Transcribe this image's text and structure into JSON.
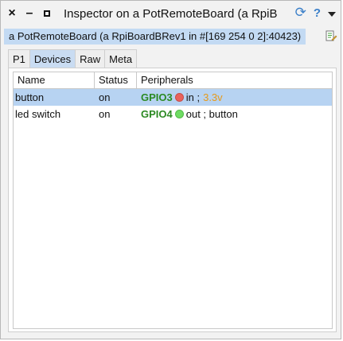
{
  "window": {
    "title": "Inspector on a PotRemoteBoard (a RpiB",
    "controls": {
      "close": "×",
      "minimize": "–",
      "refresh_glyph": "⟳",
      "help_glyph": "?"
    }
  },
  "object_bar": {
    "label": "a PotRemoteBoard (a RpiBoardBRev1 in #[169 254 0 2]:40423)"
  },
  "tabs": [
    {
      "label": "P1",
      "active": false
    },
    {
      "label": "Devices",
      "active": true
    },
    {
      "label": "Raw",
      "active": false
    },
    {
      "label": "Meta",
      "active": false
    }
  ],
  "table": {
    "columns": [
      "Name",
      "Status",
      "Peripherals"
    ],
    "rows": [
      {
        "name": "button",
        "status": "on",
        "gpio": "GPIO3",
        "indicator": "red",
        "mode": "in ;",
        "extra": "3.3v",
        "selected": true
      },
      {
        "name": "led switch",
        "status": "on",
        "gpio": "GPIO4",
        "indicator": "green",
        "mode": "out ; button",
        "extra": "",
        "selected": false
      }
    ]
  },
  "colors": {
    "selection": "#b7d3f2",
    "active_tab": "#c9dcf2",
    "object_bar": "#c3daf3",
    "gpio_text": "#2c8a23",
    "indicator_red": "#e9625c",
    "indicator_green": "#6fdc63",
    "voltage_text": "#e79a1a",
    "accent_icons": "#3c80c9"
  }
}
